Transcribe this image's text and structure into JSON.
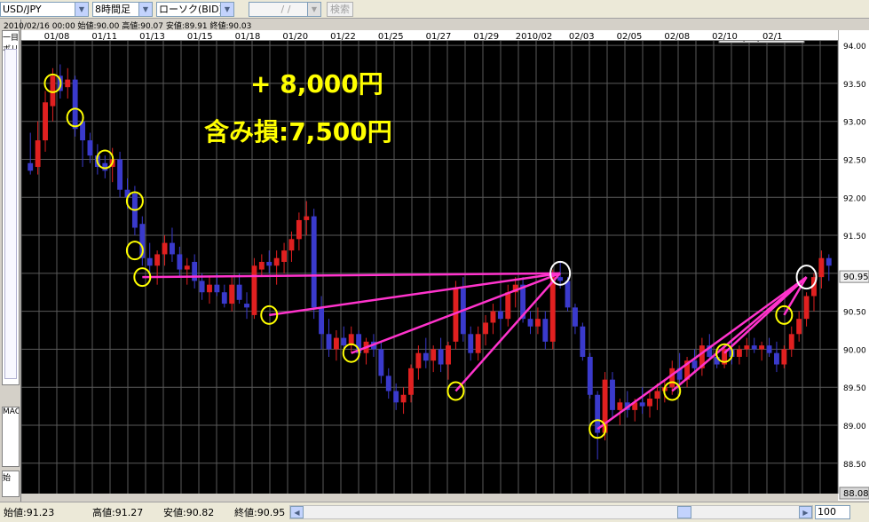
{
  "toolbar": {
    "pair": "USD/JPY",
    "timeframe": "8時間足",
    "chart_type": "ローソク(BID)",
    "date_input": "/ /",
    "search_label": "検索"
  },
  "leftpane": {
    "label1": "一目",
    "label2": "ボリ",
    "label3": "2010",
    "label4": "MAC",
    "label5": "始"
  },
  "header_ohlc": "2010/02/16 00:00 始値:90.00 高値:90.07 安値:89.91 終値:90.03",
  "cursor_label": "2010/02/16 00:00",
  "last_price": "90.95",
  "bottom_price_label": "88.08",
  "annotation": {
    "line1": "+ 8,000円",
    "line2": "含み損:7,500円"
  },
  "status": {
    "open": "始値:91.23",
    "high": "高値:91.27",
    "low": "安値:90.82",
    "close": "終値:90.95",
    "zoom": "100"
  },
  "colors": {
    "background": "#000000",
    "grid": "#5a5a5a",
    "up_candle": "#e02020",
    "down_candle": "#3a3acc",
    "annotation_line": "#ff33cc",
    "circle_yellow": "#ffff00",
    "circle_white": "#ffffff",
    "annotation_text": "#ffff00"
  },
  "chart_data": {
    "type": "candlestick",
    "ylim": [
      88.1,
      94.2
    ],
    "y_ticks": [
      "94.00",
      "93.50",
      "93.00",
      "92.50",
      "92.00",
      "91.50",
      "91.00",
      "90.50",
      "90.00",
      "89.50",
      "89.00",
      "88.50"
    ],
    "x_tick_labels": [
      "01/08",
      "01/11",
      "01/13",
      "01/15",
      "01/18",
      "01/20",
      "01/22",
      "01/25",
      "01/27",
      "01/29",
      "2010/02",
      "02/03",
      "02/05",
      "02/08",
      "02/10",
      "02/1"
    ],
    "candles": [
      {
        "o": 92.45,
        "h": 92.85,
        "l": 92.3,
        "c": 92.35
      },
      {
        "o": 92.4,
        "h": 93.0,
        "l": 92.3,
        "c": 92.75
      },
      {
        "o": 92.75,
        "h": 93.4,
        "l": 92.6,
        "c": 93.25
      },
      {
        "o": 93.2,
        "h": 93.7,
        "l": 93.0,
        "c": 93.6
      },
      {
        "o": 93.6,
        "h": 93.75,
        "l": 93.3,
        "c": 93.4
      },
      {
        "o": 93.45,
        "h": 93.7,
        "l": 93.3,
        "c": 93.55
      },
      {
        "o": 93.55,
        "h": 93.6,
        "l": 92.8,
        "c": 92.9
      },
      {
        "o": 93.0,
        "h": 93.1,
        "l": 92.4,
        "c": 92.75
      },
      {
        "o": 92.75,
        "h": 92.85,
        "l": 92.45,
        "c": 92.55
      },
      {
        "o": 92.55,
        "h": 92.7,
        "l": 92.3,
        "c": 92.4
      },
      {
        "o": 92.45,
        "h": 92.55,
        "l": 92.25,
        "c": 92.35
      },
      {
        "o": 92.4,
        "h": 92.65,
        "l": 92.2,
        "c": 92.5
      },
      {
        "o": 92.5,
        "h": 92.6,
        "l": 92.0,
        "c": 92.1
      },
      {
        "o": 92.1,
        "h": 92.25,
        "l": 91.85,
        "c": 92.0
      },
      {
        "o": 92.05,
        "h": 92.15,
        "l": 91.5,
        "c": 91.6
      },
      {
        "o": 91.65,
        "h": 91.75,
        "l": 91.1,
        "c": 91.2
      },
      {
        "o": 91.2,
        "h": 91.4,
        "l": 90.95,
        "c": 91.1
      },
      {
        "o": 91.1,
        "h": 91.3,
        "l": 90.85,
        "c": 91.25
      },
      {
        "o": 91.25,
        "h": 91.5,
        "l": 91.1,
        "c": 91.4
      },
      {
        "o": 91.4,
        "h": 91.6,
        "l": 91.15,
        "c": 91.25
      },
      {
        "o": 91.25,
        "h": 91.35,
        "l": 90.95,
        "c": 91.05
      },
      {
        "o": 91.05,
        "h": 91.2,
        "l": 90.85,
        "c": 91.1
      },
      {
        "o": 91.15,
        "h": 91.25,
        "l": 90.8,
        "c": 90.9
      },
      {
        "o": 90.9,
        "h": 91.0,
        "l": 90.65,
        "c": 90.75
      },
      {
        "o": 90.75,
        "h": 90.95,
        "l": 90.6,
        "c": 90.85
      },
      {
        "o": 90.85,
        "h": 91.0,
        "l": 90.7,
        "c": 90.75
      },
      {
        "o": 90.75,
        "h": 90.85,
        "l": 90.55,
        "c": 90.6
      },
      {
        "o": 90.6,
        "h": 90.95,
        "l": 90.5,
        "c": 90.85
      },
      {
        "o": 90.85,
        "h": 91.0,
        "l": 90.6,
        "c": 90.65
      },
      {
        "o": 90.6,
        "h": 90.75,
        "l": 90.4,
        "c": 90.55
      },
      {
        "o": 90.45,
        "h": 91.2,
        "l": 90.4,
        "c": 91.1
      },
      {
        "o": 91.05,
        "h": 91.25,
        "l": 90.95,
        "c": 91.15
      },
      {
        "o": 91.15,
        "h": 91.3,
        "l": 91.0,
        "c": 91.1
      },
      {
        "o": 91.1,
        "h": 91.3,
        "l": 90.85,
        "c": 91.2
      },
      {
        "o": 91.15,
        "h": 91.4,
        "l": 91.0,
        "c": 91.3
      },
      {
        "o": 91.3,
        "h": 91.55,
        "l": 91.15,
        "c": 91.45
      },
      {
        "o": 91.45,
        "h": 91.8,
        "l": 91.3,
        "c": 91.7
      },
      {
        "o": 91.7,
        "h": 91.95,
        "l": 91.5,
        "c": 91.75
      },
      {
        "o": 91.75,
        "h": 91.85,
        "l": 90.4,
        "c": 90.55
      },
      {
        "o": 90.55,
        "h": 90.7,
        "l": 90.0,
        "c": 90.2
      },
      {
        "o": 90.2,
        "h": 90.4,
        "l": 89.9,
        "c": 90.0
      },
      {
        "o": 90.0,
        "h": 90.25,
        "l": 89.85,
        "c": 90.15
      },
      {
        "o": 90.15,
        "h": 90.3,
        "l": 89.9,
        "c": 90.05
      },
      {
        "o": 90.05,
        "h": 90.3,
        "l": 89.95,
        "c": 90.2
      },
      {
        "o": 90.2,
        "h": 90.25,
        "l": 89.85,
        "c": 89.95
      },
      {
        "o": 89.95,
        "h": 90.15,
        "l": 89.8,
        "c": 90.1
      },
      {
        "o": 90.1,
        "h": 90.2,
        "l": 89.9,
        "c": 90.0
      },
      {
        "o": 90.0,
        "h": 90.1,
        "l": 89.55,
        "c": 89.65
      },
      {
        "o": 89.65,
        "h": 89.75,
        "l": 89.35,
        "c": 89.45
      },
      {
        "o": 89.45,
        "h": 89.55,
        "l": 89.2,
        "c": 89.3
      },
      {
        "o": 89.3,
        "h": 89.5,
        "l": 89.15,
        "c": 89.4
      },
      {
        "o": 89.4,
        "h": 89.8,
        "l": 89.3,
        "c": 89.75
      },
      {
        "o": 89.75,
        "h": 90.05,
        "l": 89.6,
        "c": 89.95
      },
      {
        "o": 89.95,
        "h": 90.15,
        "l": 89.75,
        "c": 89.85
      },
      {
        "o": 89.85,
        "h": 90.05,
        "l": 89.7,
        "c": 90.0
      },
      {
        "o": 90.0,
        "h": 90.15,
        "l": 89.7,
        "c": 89.8
      },
      {
        "o": 89.8,
        "h": 90.1,
        "l": 89.6,
        "c": 90.05
      },
      {
        "o": 90.1,
        "h": 90.9,
        "l": 90.0,
        "c": 90.8
      },
      {
        "o": 90.8,
        "h": 90.95,
        "l": 90.1,
        "c": 90.2
      },
      {
        "o": 90.2,
        "h": 90.3,
        "l": 89.85,
        "c": 89.95
      },
      {
        "o": 89.95,
        "h": 90.3,
        "l": 89.85,
        "c": 90.2
      },
      {
        "o": 90.2,
        "h": 90.45,
        "l": 90.05,
        "c": 90.35
      },
      {
        "o": 90.35,
        "h": 90.6,
        "l": 90.2,
        "c": 90.5
      },
      {
        "o": 90.5,
        "h": 90.7,
        "l": 90.25,
        "c": 90.4
      },
      {
        "o": 90.4,
        "h": 90.85,
        "l": 90.3,
        "c": 90.75
      },
      {
        "o": 90.75,
        "h": 90.95,
        "l": 90.55,
        "c": 90.85
      },
      {
        "o": 90.85,
        "h": 90.95,
        "l": 90.35,
        "c": 90.4
      },
      {
        "o": 90.4,
        "h": 90.5,
        "l": 90.2,
        "c": 90.3
      },
      {
        "o": 90.3,
        "h": 90.55,
        "l": 90.2,
        "c": 90.4
      },
      {
        "o": 90.4,
        "h": 90.5,
        "l": 90.0,
        "c": 90.1
      },
      {
        "o": 90.1,
        "h": 91.05,
        "l": 90.0,
        "c": 90.95
      },
      {
        "o": 90.95,
        "h": 91.15,
        "l": 90.8,
        "c": 90.9
      },
      {
        "o": 90.9,
        "h": 90.95,
        "l": 90.5,
        "c": 90.55
      },
      {
        "o": 90.55,
        "h": 90.6,
        "l": 90.2,
        "c": 90.3
      },
      {
        "o": 90.3,
        "h": 90.35,
        "l": 89.85,
        "c": 89.9
      },
      {
        "o": 89.9,
        "h": 89.95,
        "l": 89.35,
        "c": 89.4
      },
      {
        "o": 89.4,
        "h": 89.45,
        "l": 88.55,
        "c": 88.9
      },
      {
        "o": 88.9,
        "h": 89.7,
        "l": 88.8,
        "c": 89.6
      },
      {
        "o": 89.6,
        "h": 89.7,
        "l": 89.1,
        "c": 89.2
      },
      {
        "o": 89.2,
        "h": 89.35,
        "l": 89.0,
        "c": 89.3
      },
      {
        "o": 89.3,
        "h": 89.45,
        "l": 89.1,
        "c": 89.2
      },
      {
        "o": 89.2,
        "h": 89.35,
        "l": 89.05,
        "c": 89.3
      },
      {
        "o": 89.3,
        "h": 89.5,
        "l": 89.15,
        "c": 89.25
      },
      {
        "o": 89.25,
        "h": 89.45,
        "l": 89.1,
        "c": 89.35
      },
      {
        "o": 89.35,
        "h": 89.55,
        "l": 89.2,
        "c": 89.45
      },
      {
        "o": 89.45,
        "h": 89.6,
        "l": 89.3,
        "c": 89.5
      },
      {
        "o": 89.5,
        "h": 89.85,
        "l": 89.4,
        "c": 89.75
      },
      {
        "o": 89.75,
        "h": 89.95,
        "l": 89.55,
        "c": 89.6
      },
      {
        "o": 89.6,
        "h": 89.9,
        "l": 89.5,
        "c": 89.85
      },
      {
        "o": 89.85,
        "h": 90.0,
        "l": 89.7,
        "c": 89.75
      },
      {
        "o": 89.75,
        "h": 90.15,
        "l": 89.65,
        "c": 90.05
      },
      {
        "o": 90.05,
        "h": 90.2,
        "l": 89.85,
        "c": 89.9
      },
      {
        "o": 89.9,
        "h": 90.0,
        "l": 89.75,
        "c": 89.8
      },
      {
        "o": 89.8,
        "h": 90.05,
        "l": 89.75,
        "c": 90.0
      },
      {
        "o": 90.0,
        "h": 90.1,
        "l": 89.8,
        "c": 89.9
      },
      {
        "o": 89.9,
        "h": 90.05,
        "l": 89.8,
        "c": 90.0
      },
      {
        "o": 90.0,
        "h": 90.15,
        "l": 89.9,
        "c": 90.05
      },
      {
        "o": 90.05,
        "h": 90.15,
        "l": 89.95,
        "c": 90.0
      },
      {
        "o": 90.0,
        "h": 90.1,
        "l": 89.85,
        "c": 90.05
      },
      {
        "o": 90.05,
        "h": 90.15,
        "l": 89.9,
        "c": 89.95
      },
      {
        "o": 89.95,
        "h": 90.1,
        "l": 89.7,
        "c": 89.8
      },
      {
        "o": 89.8,
        "h": 90.05,
        "l": 89.75,
        "c": 90.0
      },
      {
        "o": 90.0,
        "h": 90.3,
        "l": 89.9,
        "c": 90.2
      },
      {
        "o": 90.2,
        "h": 90.5,
        "l": 90.1,
        "c": 90.4
      },
      {
        "o": 90.4,
        "h": 90.75,
        "l": 90.3,
        "c": 90.7
      },
      {
        "o": 90.7,
        "h": 91.0,
        "l": 90.5,
        "c": 90.95
      },
      {
        "o": 90.95,
        "h": 91.3,
        "l": 90.8,
        "c": 91.2
      },
      {
        "o": 91.2,
        "h": 91.25,
        "l": 90.9,
        "c": 91.1
      }
    ],
    "circled_points_yellow": [
      [
        3,
        93.5
      ],
      [
        6,
        93.05
      ],
      [
        10,
        92.5
      ],
      [
        14,
        91.95
      ],
      [
        14,
        91.3
      ],
      [
        15,
        90.95
      ],
      [
        32,
        90.45
      ],
      [
        43,
        89.95
      ],
      [
        57,
        89.45
      ],
      [
        76,
        88.95
      ],
      [
        86,
        89.45
      ],
      [
        93,
        89.95
      ],
      [
        101,
        90.45
      ]
    ],
    "circled_points_white": [
      [
        71,
        91.0
      ],
      [
        104,
        90.95
      ]
    ],
    "lines": [
      [
        [
          15,
          90.95
        ],
        [
          71,
          91.0
        ]
      ],
      [
        [
          32,
          90.45
        ],
        [
          71,
          91.0
        ]
      ],
      [
        [
          43,
          89.95
        ],
        [
          71,
          91.0
        ]
      ],
      [
        [
          57,
          89.45
        ],
        [
          71,
          91.0
        ]
      ],
      [
        [
          76,
          88.95
        ],
        [
          104,
          90.95
        ]
      ],
      [
        [
          86,
          89.45
        ],
        [
          104,
          90.95
        ]
      ],
      [
        [
          93,
          89.95
        ],
        [
          104,
          90.95
        ]
      ],
      [
        [
          101,
          90.45
        ],
        [
          104,
          90.95
        ]
      ]
    ]
  }
}
